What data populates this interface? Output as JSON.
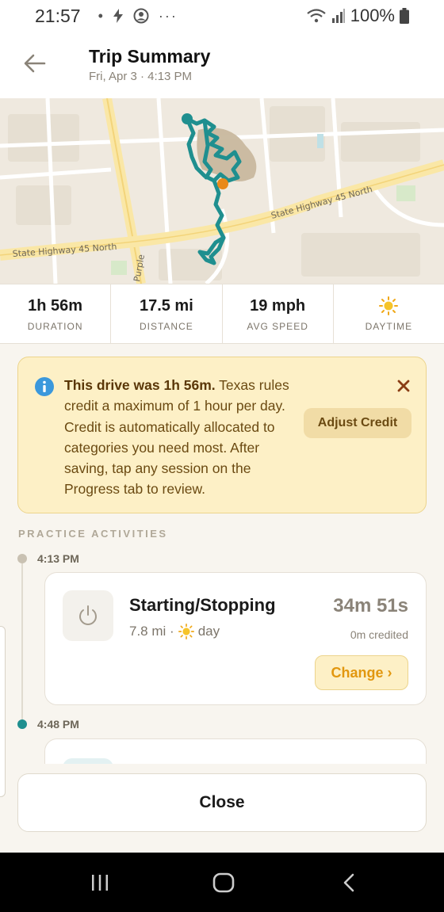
{
  "status_bar": {
    "time": "21:57",
    "battery": "100%"
  },
  "header": {
    "title": "Trip Summary",
    "subtitle": "Fri, Apr 3 · 4:13 PM"
  },
  "map": {
    "road_labels": [
      "State Highway 45 North",
      "State Highway 45 North",
      "Purple"
    ]
  },
  "stats": [
    {
      "value": "1h 56m",
      "label": "DURATION"
    },
    {
      "value": "17.5 mi",
      "label": "DISTANCE"
    },
    {
      "value": "19 mph",
      "label": "AVG SPEED"
    },
    {
      "value": "",
      "label": "DAYTIME",
      "icon": "sun-icon"
    }
  ],
  "notice": {
    "bold": "This drive was 1h 56m.",
    "text": " Texas rules credit a maximum of 1 hour per day. Credit is automatically allocated to categories you need most. After saving, tap any session on the Progress tab to review.",
    "adjust_label": "Adjust Credit"
  },
  "section_title": "PRACTICE ACTIVITIES",
  "activities": [
    {
      "time": "4:13 PM",
      "title": "Starting/Stopping",
      "distance": "7.8 mi ·",
      "period": "day",
      "duration": "34m 51s",
      "credited": "0m credited",
      "change_label": "Change ›",
      "icon": "power-icon"
    },
    {
      "time": "4:48 PM"
    }
  ],
  "close_label": "Close",
  "colors": {
    "accent": "#1f8f8f",
    "orange": "#e8891a",
    "notice_bg": "#fdf0c6",
    "notice_text": "#6b4a12"
  }
}
